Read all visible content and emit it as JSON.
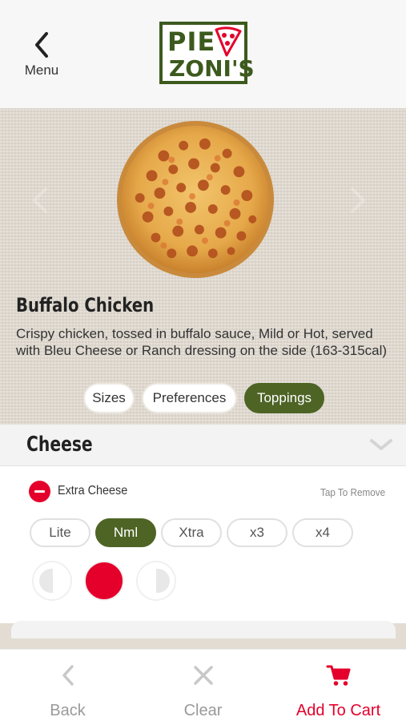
{
  "header": {
    "menu_label": "Menu",
    "logo_line1": "PIE",
    "logo_line2": "ZONI'S",
    "brand_color": "#3d5a1e"
  },
  "item": {
    "title": "Buffalo Chicken",
    "description": "Crispy chicken, tossed in buffalo sauce, Mild or Hot, served with Bleu Cheese or Ranch dressing on the side (163-315cal)"
  },
  "tabs": [
    {
      "label": "Sizes",
      "active": false
    },
    {
      "label": "Preferences",
      "active": false
    },
    {
      "label": "Toppings",
      "active": true
    }
  ],
  "section": {
    "title": "Cheese",
    "topping": {
      "name": "Extra Cheese",
      "remove_hint": "Tap To Remove",
      "amounts": [
        "Lite",
        "Nml",
        "Xtra",
        "x3",
        "x4"
      ],
      "selected_amount": "Nml",
      "placement_options": [
        "left-half",
        "whole",
        "right-half"
      ],
      "selected_placement": "whole"
    }
  },
  "bottom_bar": {
    "back_label": "Back",
    "clear_label": "Clear",
    "add_to_cart_label": "Add To Cart"
  },
  "colors": {
    "accent_green": "#4e6425",
    "accent_red": "#e4002b",
    "muted": "#9a9a9a"
  }
}
